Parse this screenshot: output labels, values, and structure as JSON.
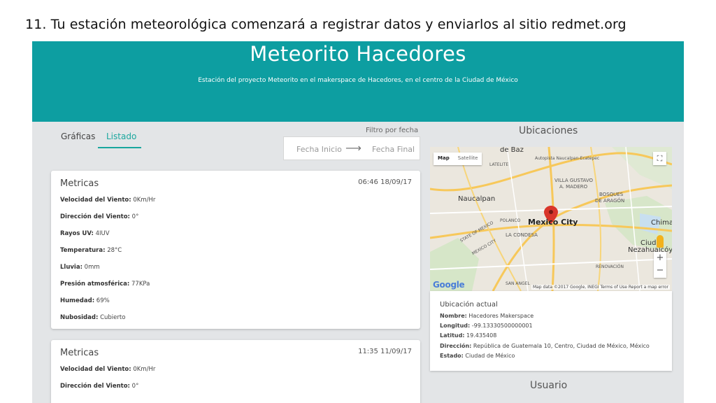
{
  "slide_title": "11. Tu estación meteorológica comenzará a registrar datos y enviarlos al sitio redmet.org",
  "header": {
    "title": "Meteorito Hacedores",
    "subtitle": "Estación del proyecto Meteorito en el makerspace de Hacedores, en el centro de la Ciudad de México"
  },
  "tabs": [
    {
      "label": "Gráficas"
    },
    {
      "label": "Listado"
    }
  ],
  "filter": {
    "label": "Filtro por fecha",
    "start_placeholder": "Fecha Inicio",
    "arrow": "⟶",
    "end_placeholder": "Fecha Final"
  },
  "cards": [
    {
      "title": "Metricas",
      "time": "06:46 18/09/17",
      "rows": [
        {
          "label": "Velocidad del Viento:",
          "value": " 0Km/Hr"
        },
        {
          "label": "Dirección del Viento:",
          "value": " 0°"
        },
        {
          "label": "Rayos UV:",
          "value": " 4IUV"
        },
        {
          "label": "Temperatura:",
          "value": " 28°C"
        },
        {
          "label": "Lluvia:",
          "value": " 0mm"
        },
        {
          "label": "Presión atmosférica:",
          "value": " 77KPa"
        },
        {
          "label": "Humedad:",
          "value": " 69%"
        },
        {
          "label": "Nubosidad:",
          "value": " Cubierto"
        }
      ]
    },
    {
      "title": "Metricas",
      "time": "11:35 11/09/17",
      "rows": [
        {
          "label": "Velocidad del Viento:",
          "value": " 0Km/Hr"
        },
        {
          "label": "Dirección del Viento:",
          "value": " 0°"
        }
      ]
    }
  ],
  "locations": {
    "title": "Ubicaciones",
    "map": {
      "type_map": "Map",
      "type_satellite": "Satellite",
      "fullscreen_icon": "⛶",
      "zoom_in": "+",
      "zoom_out": "−",
      "google": "Google",
      "attribution": "Map data ©2017 Google, INEGI   Terms of Use   Report a map error",
      "labels": {
        "de_baz": "de Baz",
        "autopista": "Autopista Naucalpan-Ecatepec",
        "satelite": "LATELITE",
        "villa_gustavo": "VILLA GUSTAVO",
        "a_madero": "A. MADERO",
        "bosques": "BOSQUES",
        "de_aragon": "DE ARAGÓN",
        "naucalpan": "Naucalpan",
        "polanco": "POLANCO",
        "mexico_city": "Mexico City",
        "la_condesa": "LA CONDESA",
        "state_mexico": "STATE OF MEXICO",
        "mexico_city_small": "MEXICO CITY",
        "cd": "Ciud",
        "nezahualcoyotl": "Nezahualcóyotl",
        "chimal": "Chimal",
        "renovacion": "RENOVACIÓN",
        "san_angel": "SAN ANGEL"
      }
    },
    "current": {
      "title": "Ubicación actual",
      "rows": [
        {
          "label": "Nombre:",
          "value": " Hacedores Makerspace"
        },
        {
          "label": "Longitud:",
          "value": " -99.13330500000001"
        },
        {
          "label": "Latitud:",
          "value": " 19.435408"
        },
        {
          "label": "Dirección:",
          "value": " República de Guatemala 10, Centro, Ciudad de México, México"
        },
        {
          "label": "Estado:",
          "value": " Ciudad de México"
        }
      ]
    }
  },
  "user_section": {
    "title": "Usuario"
  },
  "colors": {
    "header_teal": "#0d9ea1",
    "accent_green": "#1aa79e",
    "page_bg": "#e3e5e7",
    "marker_red": "#d9362b"
  }
}
